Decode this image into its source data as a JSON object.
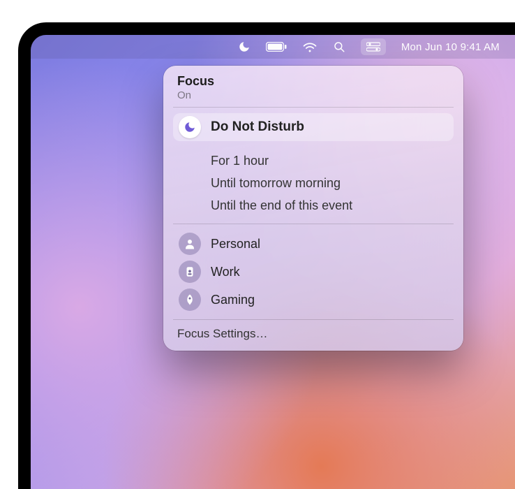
{
  "menubar": {
    "clock": "Mon Jun 10  9:41 AM"
  },
  "popover": {
    "title": "Focus",
    "subtitle": "On",
    "dnd": {
      "label": "Do Not Disturb"
    },
    "durations": [
      {
        "label": "For 1 hour"
      },
      {
        "label": "Until tomorrow morning"
      },
      {
        "label": "Until the end of this event"
      }
    ],
    "modes": [
      {
        "label": "Personal",
        "icon": "person"
      },
      {
        "label": "Work",
        "icon": "badge"
      },
      {
        "label": "Gaming",
        "icon": "rocket"
      }
    ],
    "settings_label": "Focus Settings…"
  }
}
